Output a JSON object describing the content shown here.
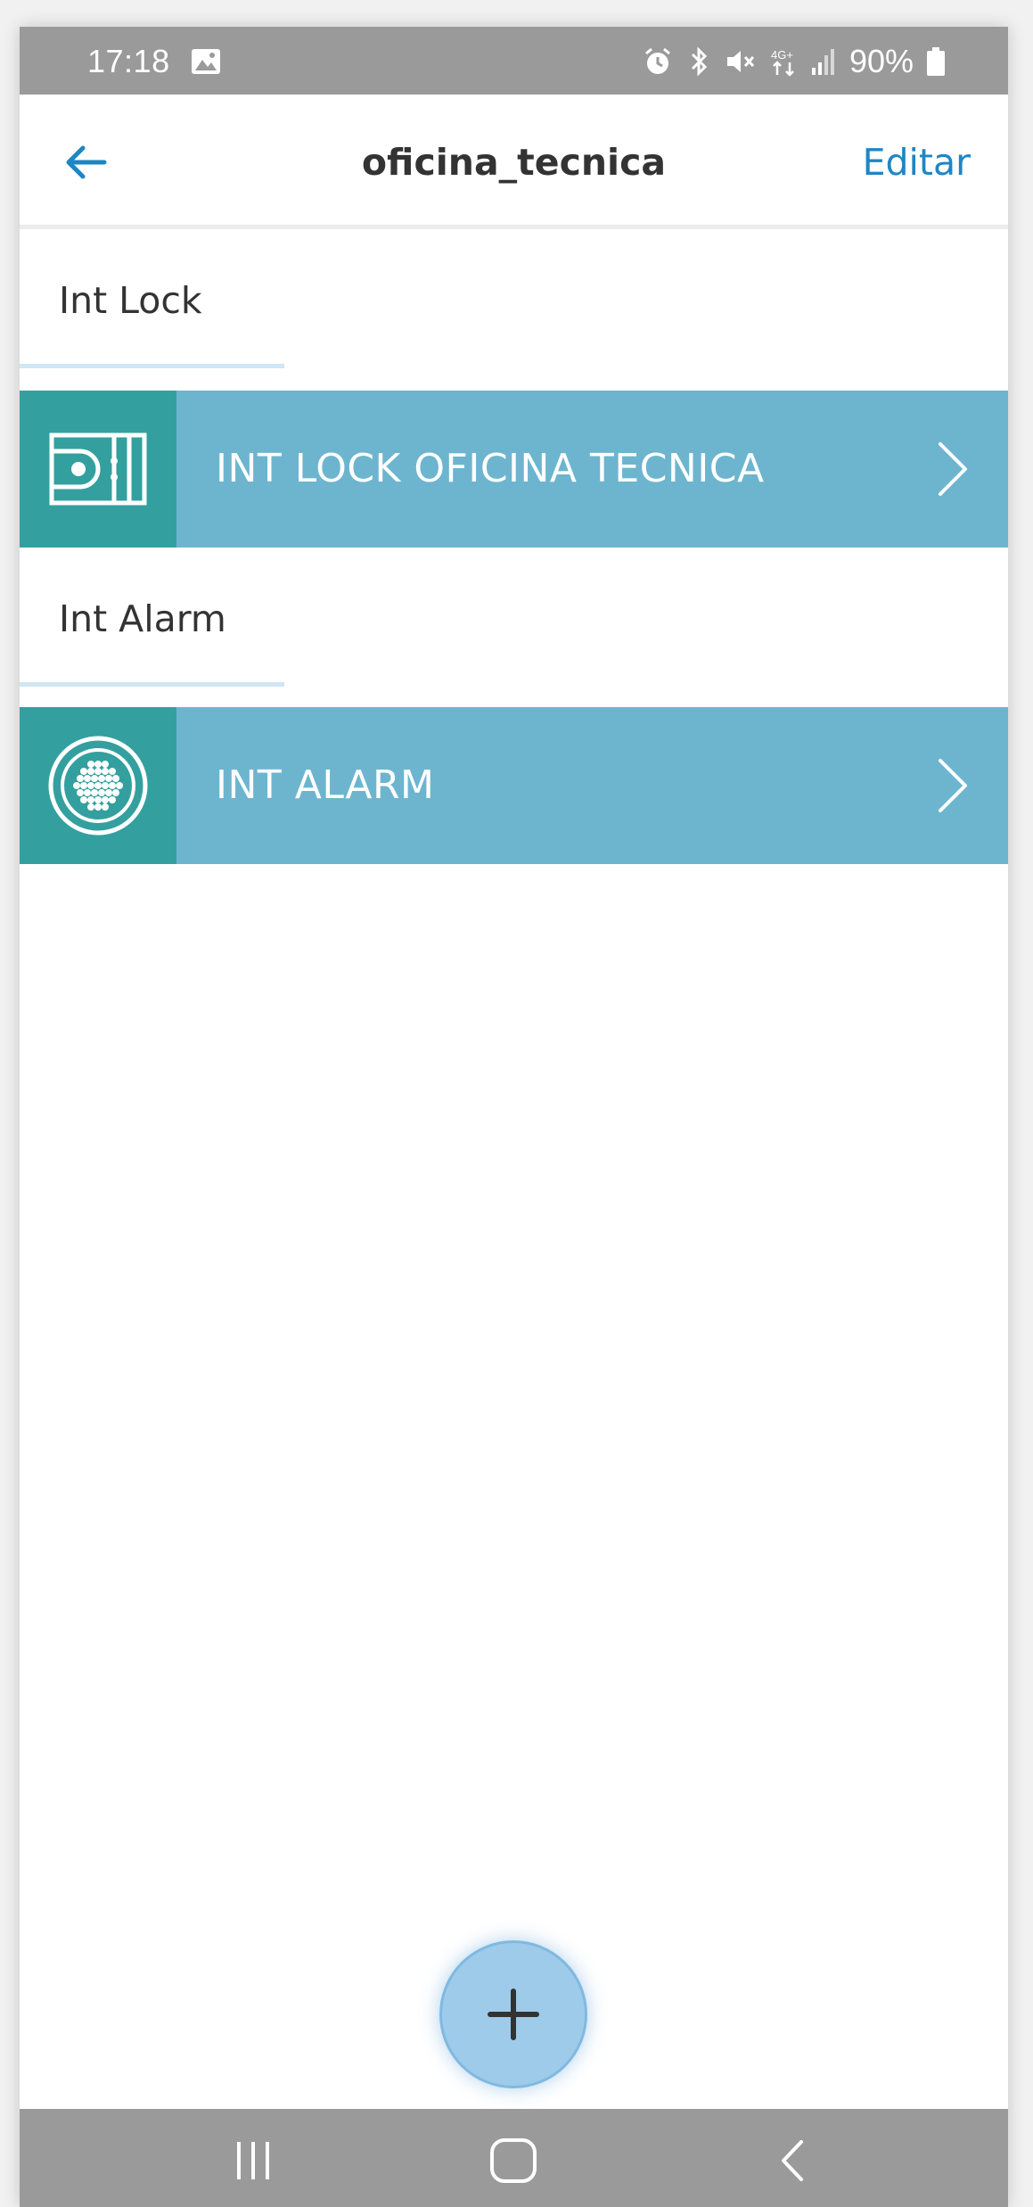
{
  "status_bar": {
    "time": "17:18",
    "battery": "90%"
  },
  "header": {
    "title": "oficina_tecnica",
    "edit_label": "Editar"
  },
  "sections": [
    {
      "label": "Int Lock",
      "device": {
        "name": "INT LOCK OFICINA TECNICA",
        "icon": "lock-device-icon"
      }
    },
    {
      "label": "Int Alarm",
      "device": {
        "name": "INT ALARM",
        "icon": "alarm-speaker-icon"
      }
    }
  ],
  "colors": {
    "accent": "#1e86c4",
    "row_background": "#6db5cf",
    "icon_background": "#33a09f",
    "fab": "#9ecbea",
    "system_bars": "#9a9a9a"
  }
}
